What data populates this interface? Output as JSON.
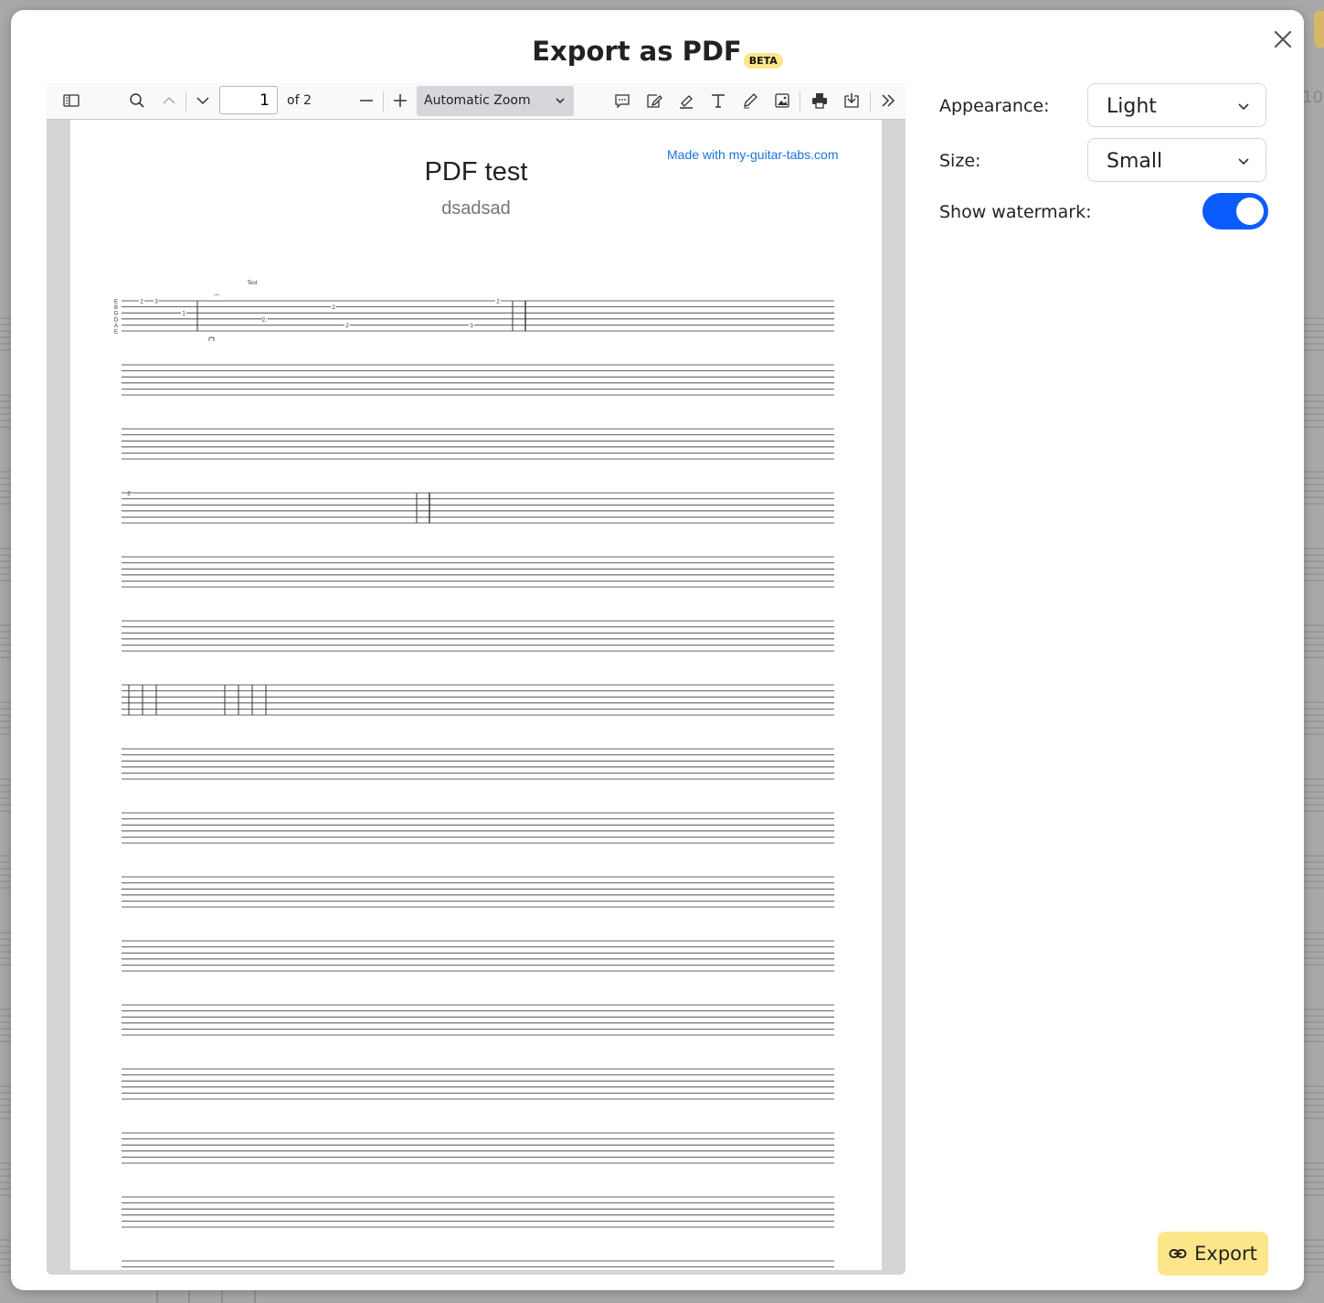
{
  "dialog": {
    "title": "Export as PDF",
    "badge": "BETA"
  },
  "viewer_toolbar": {
    "page_current": "1",
    "page_total_label": "of 2",
    "zoom_label": "Automatic Zoom"
  },
  "pdf_page": {
    "watermark": "Made with my-guitar-tabs.com",
    "title": "PDF test",
    "subtitle": "dsadsad",
    "section_label": "Test",
    "string_names": [
      "E",
      "B",
      "G",
      "D",
      "A",
      "E"
    ],
    "notes": [
      "2",
      "3",
      "1",
      "2↑",
      "2",
      "2",
      "2",
      "3",
      "2"
    ]
  },
  "options": {
    "appearance_label": "Appearance:",
    "appearance_value": "Light",
    "size_label": "Size:",
    "size_value": "Small",
    "watermark_label": "Show watermark:",
    "watermark_on": true
  },
  "export": {
    "label": "Export"
  },
  "background": {
    "number": "10"
  },
  "colors": {
    "accent_blue": "#0a5cff",
    "export_yellow": "#fde68a",
    "link_blue": "#1a73d9"
  }
}
